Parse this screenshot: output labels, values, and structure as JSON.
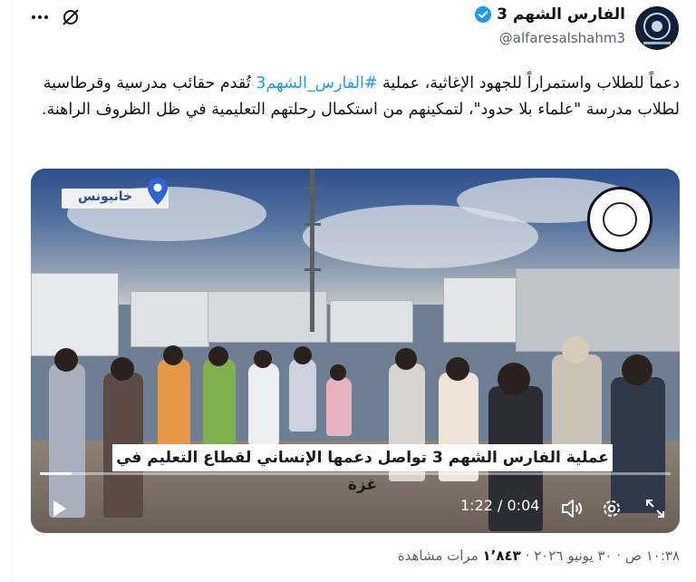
{
  "header": {
    "display_name": "الفارس الشهم 3",
    "handle": "@alfaresalshahm3",
    "verified": true,
    "accent_color": "#1d9bf0",
    "icons": {
      "more": "more-dots-icon",
      "grok": "grok-icon",
      "verified": "verified-badge-icon"
    }
  },
  "tweet": {
    "text_part1": "دعماً للطلاب واستمراراً للجهود الإغاثية، عملية ",
    "hashtag": "#الفارس_الشهم3",
    "text_part2": " تُقدم حقائب مدرسية وقرطاسية لطلاب مدرسة \"علماء بلا حدود\"، لتمكينهم من استكمال رحلتهم التعليمية في ظل الظروف الراهنة."
  },
  "video": {
    "location_label": "خانيونس",
    "caption": "عملية الفارس الشهم 3 تواصل دعمها الإنساني لقطاع التعليم في غزة",
    "time_display": "1:22 / 0:04",
    "progress_fraction": 0.05,
    "controls": {
      "play": "play-icon",
      "volume": "volume-icon",
      "settings": "settings-gear-icon",
      "fullscreen": "fullscreen-icon"
    }
  },
  "meta": {
    "time": "١٠:٣٨ ص",
    "sep": "·",
    "date": "٣٠ يونيو ٢٠٢٦",
    "views_count": "١٬٨٤٣",
    "views_label": "مرات مشاهدة"
  }
}
